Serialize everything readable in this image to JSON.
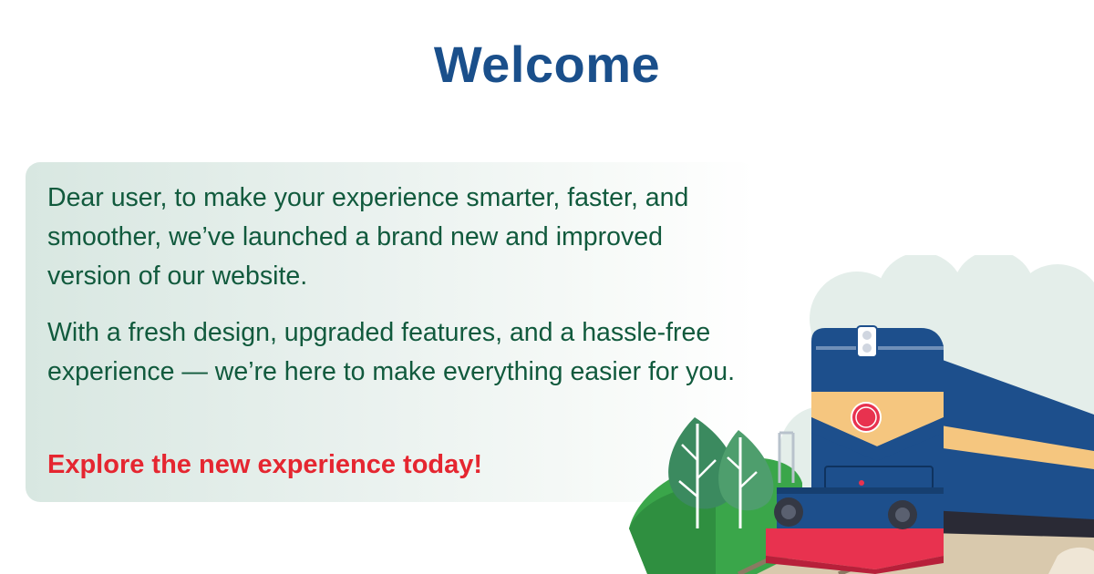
{
  "header": {
    "title": "Welcome"
  },
  "message": {
    "paragraph_1": "Dear user, to make your experience smarter, faster, and smoother, we’ve launched a brand new and improved version of our website.",
    "paragraph_2": "With a fresh design, upgraded features, and a hassle-free experience — we’re here to make everything easier for you.",
    "call_to_action": "Explore the new experience today!"
  },
  "colors": {
    "title": "#1a4f8b",
    "body_text": "#115a3d",
    "call_to_action": "#e52630",
    "train_body": "#1d4f8c",
    "train_stripe": "#f5c67f",
    "train_front": "#e8324f"
  },
  "illustration": {
    "subject": "train-illustration"
  }
}
